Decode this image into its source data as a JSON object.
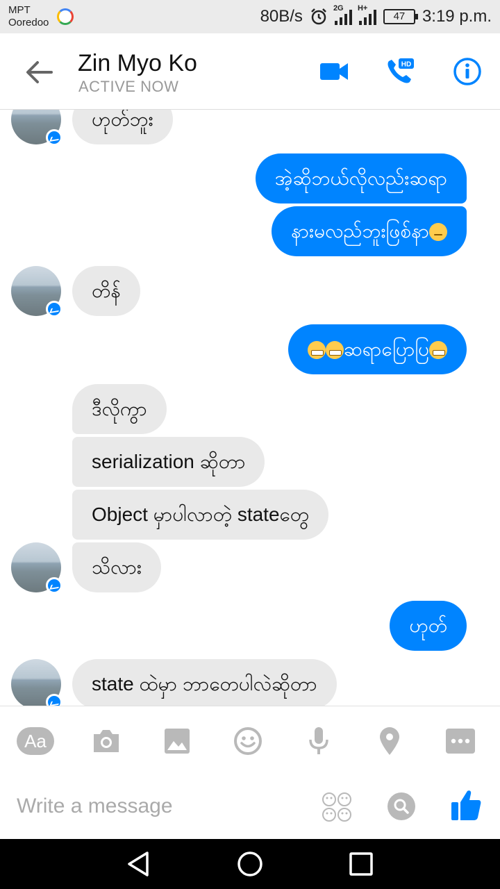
{
  "status_bar": {
    "carrier_line1": "MPT",
    "carrier_line2": "Ooredoo",
    "net_speed": "80B/s",
    "net_2g": "2G",
    "net_hplus": "H+",
    "battery": "47",
    "time": "3:19 p.m."
  },
  "header": {
    "contact_name": "Zin Myo Ko",
    "presence": "ACTIVE NOW"
  },
  "messages": [
    {
      "from": "them",
      "text": "ဟုတ်ဘူး"
    },
    {
      "from": "me",
      "text": "အဲ့ဆိုဘယ်လိုလည်းဆရာ"
    },
    {
      "from": "me",
      "text": "နားမလည်ဘူးဖြစ်နာ",
      "emoji": "pensive-emoji"
    },
    {
      "from": "them",
      "text": "တိန်"
    },
    {
      "from": "me",
      "text": "ဆရာပြောပြ",
      "emoji": "grin-emoji"
    },
    {
      "from": "them",
      "text": "ဒီလိုကွာ"
    },
    {
      "from": "them",
      "text": "serialization ဆိုတာ"
    },
    {
      "from": "them",
      "text": "Object မှာပါလာတဲ့ stateတွေ"
    },
    {
      "from": "them",
      "text": "သိလား"
    },
    {
      "from": "me",
      "text": "ဟုတ်"
    },
    {
      "from": "them",
      "text": "state ထဲမှာ ဘာတေပါလဲဆိုတာ"
    }
  ],
  "composer": {
    "aa_label": "Aa",
    "placeholder": "Write a message",
    "tools": [
      "aa-icon",
      "camera-icon",
      "image-icon",
      "emoji-icon",
      "microphone-icon",
      "location-icon",
      "more-icon"
    ]
  },
  "colors": {
    "accent": "#0084ff",
    "incoming_bubble": "#e9e9e9",
    "composer_icon": "#b9b9b9"
  }
}
